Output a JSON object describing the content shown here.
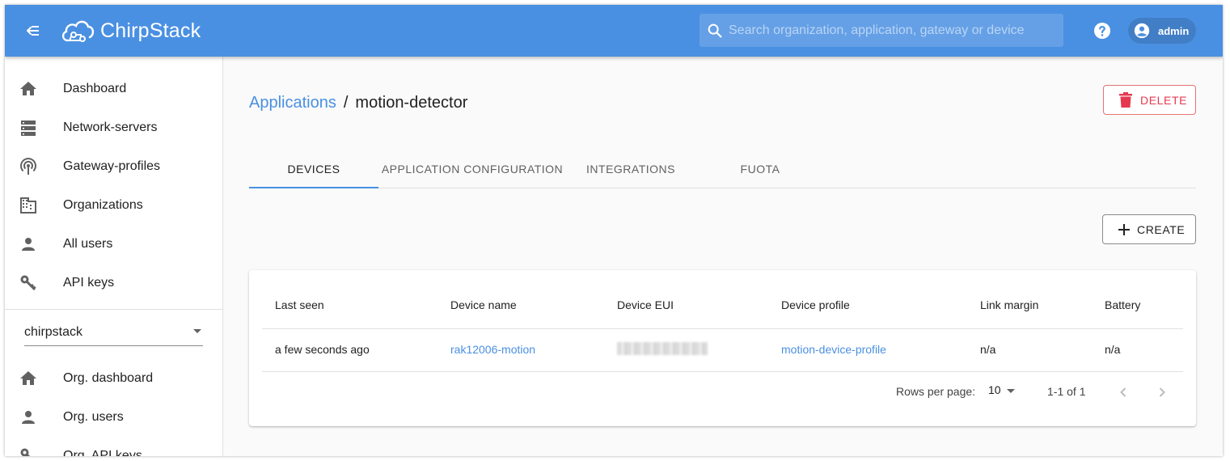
{
  "app": {
    "name": "ChirpStack"
  },
  "topbar": {
    "search_placeholder": "Search organization, application, gateway or device",
    "user": "admin"
  },
  "sidebar": {
    "items": [
      {
        "label": "Dashboard",
        "icon": "home-icon"
      },
      {
        "label": "Network-servers",
        "icon": "server-icon"
      },
      {
        "label": "Gateway-profiles",
        "icon": "access-point-icon"
      },
      {
        "label": "Organizations",
        "icon": "domain-icon"
      },
      {
        "label": "All users",
        "icon": "account-icon"
      },
      {
        "label": "API keys",
        "icon": "key-icon"
      }
    ],
    "organization": "chirpstack",
    "org_items": [
      {
        "label": "Org. dashboard",
        "icon": "home-icon"
      },
      {
        "label": "Org. users",
        "icon": "account-icon"
      },
      {
        "label": "Org. API keys",
        "icon": "key-icon"
      }
    ]
  },
  "breadcrumb": {
    "parent": "Applications",
    "separator": "/",
    "current": "motion-detector"
  },
  "actions": {
    "delete": "DELETE",
    "create": "CREATE"
  },
  "tabs": [
    {
      "label": "DEVICES",
      "active": true
    },
    {
      "label": "APPLICATION CONFIGURATION",
      "active": false
    },
    {
      "label": "INTEGRATIONS",
      "active": false
    },
    {
      "label": "FUOTA",
      "active": false
    }
  ],
  "table": {
    "columns": [
      "Last seen",
      "Device name",
      "Device EUI",
      "Device profile",
      "Link margin",
      "Battery"
    ],
    "rows": [
      {
        "last_seen": "a few seconds ago",
        "device_name": "rak12006-motion",
        "device_eui": "",
        "device_profile": "motion-device-profile",
        "link_margin": "n/a",
        "battery": "n/a"
      }
    ]
  },
  "pagination": {
    "rows_per_page_label": "Rows per page:",
    "rows_per_page": "10",
    "range": "1-1 of 1"
  },
  "colors": {
    "primary": "#4a90e2",
    "danger": "#e53950",
    "background": "#fafafa"
  }
}
